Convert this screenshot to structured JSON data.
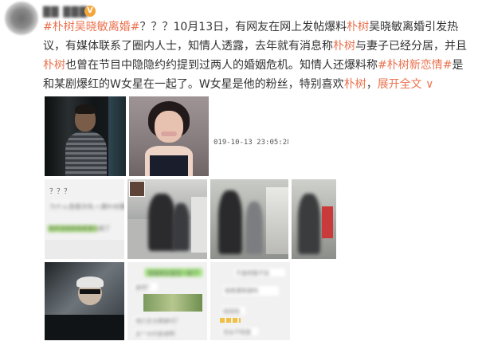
{
  "post": {
    "username": "██ ███",
    "verified_badge": "V",
    "hashtag1": "#朴树吴晓敏离婚#",
    "text1": "？？？10月13日，有网友在网上发帖爆料",
    "link1": "朴树",
    "text2": "吴晓敏离婚引发热议，有媒体联系了圈内人士，知情人透露，去年就有消息称",
    "link2": "朴树",
    "text3": "与妻子已经分居，并且",
    "link3": "朴树",
    "text4": "也曾在节目中隐隐约约提到过两人的婚姻危机。知情人还爆料称",
    "hashtag2": "#朴树新恋情#",
    "text5": "是和某剧爆红的W女星在一起了。W女星是他的粉丝，特别喜欢",
    "link4": "朴树",
    "text6": "，",
    "expand": "展开全文 ∨"
  },
  "images": {
    "timestamp": "019-10-13 23:05:28",
    "chat1_header": "？？？",
    "chat1_line1": "为什么我看到有人爆朴树离婚",
    "chat1_line2": "就听说他和他老婆分居了",
    "chat2_line1": "就是和女星在一起了",
    "chat2_line2": "是吧？",
    "chat2_line3": "他们还没离婚吗？",
    "chat2_line4": "这个女的是谁啊",
    "chat3_line1": "不是吧我不信",
    "chat3_line2": "他老婆知道吗",
    "chat3_line3": "哈哈哈",
    "chat3_line4": "完全不知道"
  }
}
